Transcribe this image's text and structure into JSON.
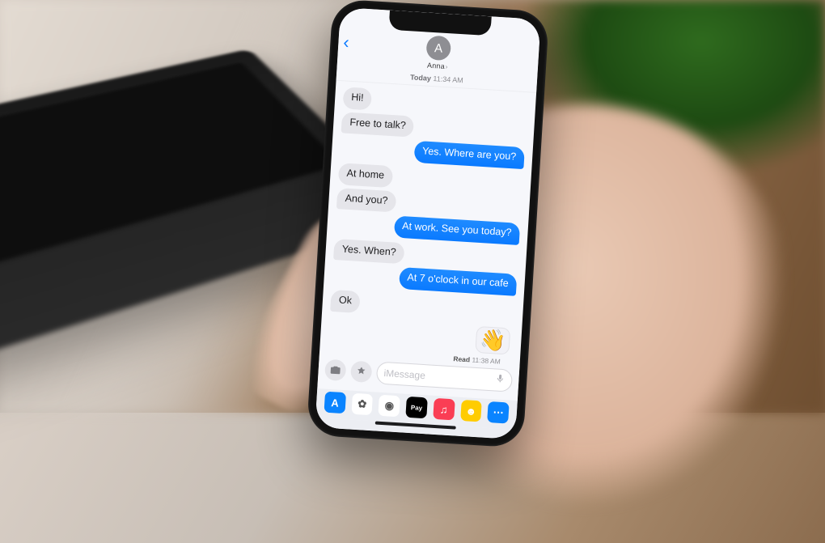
{
  "contact": {
    "name": "Anna",
    "initial": "A"
  },
  "timestamp": {
    "day": "Today",
    "time": "11:34 AM"
  },
  "messages": [
    {
      "dir": "in",
      "text": "Hi!"
    },
    {
      "dir": "in",
      "text": "Free to talk?"
    },
    {
      "dir": "out",
      "text": "Yes. Where are you?"
    },
    {
      "dir": "in",
      "text": "At home"
    },
    {
      "dir": "in",
      "text": "And you?"
    },
    {
      "dir": "out",
      "text": "At work. See you today?"
    },
    {
      "dir": "in",
      "text": "Yes. When?"
    },
    {
      "dir": "out",
      "text": "At 7 o'clock in our cafe"
    },
    {
      "dir": "in",
      "text": "Ok"
    }
  ],
  "receipt": {
    "label": "Read",
    "time": "11:38 AM"
  },
  "input": {
    "placeholder": "iMessage"
  },
  "apps": [
    {
      "name": "store-icon",
      "bg": "#0a84ff",
      "glyph": "A"
    },
    {
      "name": "photos-icon",
      "bg": "#ffffff",
      "glyph": "✿"
    },
    {
      "name": "chrome-icon",
      "bg": "#ffffff",
      "glyph": "◉"
    },
    {
      "name": "applepay-icon",
      "bg": "#000000",
      "glyph": "Pay"
    },
    {
      "name": "music-icon",
      "bg": "#fa3e54",
      "glyph": "♫"
    },
    {
      "name": "memoji-icon",
      "bg": "#ffcc00",
      "glyph": "☻"
    },
    {
      "name": "more-icon",
      "bg": "#0a84ff",
      "glyph": "⋯"
    }
  ]
}
